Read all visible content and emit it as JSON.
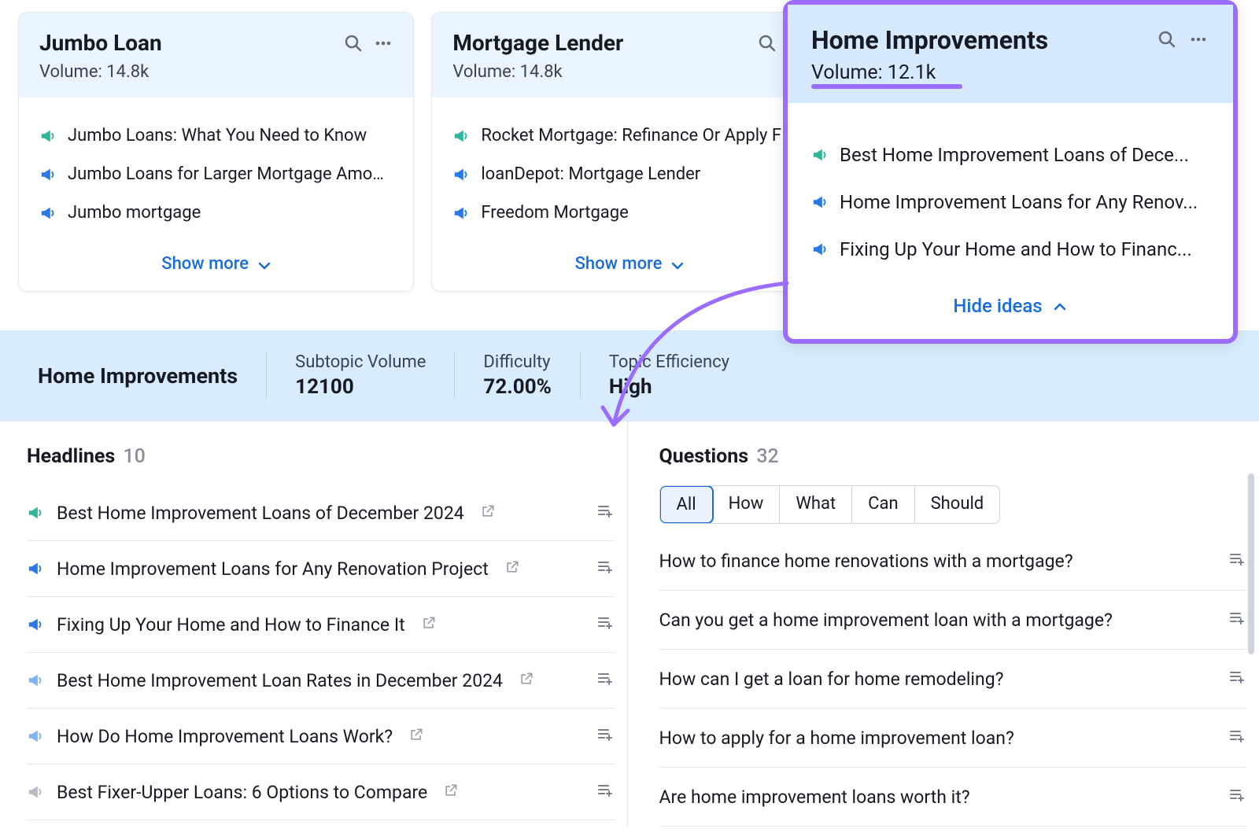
{
  "cards": [
    {
      "title": "Jumbo Loan",
      "volume_label": "Volume: 14.8k",
      "ideas": [
        {
          "text": "Jumbo Loans: What You Need to Know",
          "color": "teal"
        },
        {
          "text": "Jumbo Loans for Larger Mortgage Amou...",
          "color": "blue"
        },
        {
          "text": "Jumbo mortgage",
          "color": "blue"
        }
      ],
      "show_more": "Show more"
    },
    {
      "title": "Mortgage Lender",
      "volume_label": "Volume: 14.8k",
      "ideas": [
        {
          "text": "Rocket Mortgage: Refinance Or Apply F",
          "color": "teal"
        },
        {
          "text": "loanDepot: Mortgage Lender",
          "color": "blue"
        },
        {
          "text": "Freedom Mortgage",
          "color": "blue"
        }
      ],
      "show_more": "Show more"
    }
  ],
  "highlighted": {
    "title": "Home Improvements",
    "volume_label": "Volume: 12.1k",
    "ideas": [
      {
        "text": "Best Home Improvement Loans of Dece...",
        "color": "teal"
      },
      {
        "text": "Home Improvement Loans for Any Renov...",
        "color": "blue"
      },
      {
        "text": "Fixing Up Your Home and How to Financ...",
        "color": "blue"
      }
    ],
    "hide_ideas": "Hide ideas"
  },
  "details": {
    "title": "Home Improvements",
    "metrics": [
      {
        "label": "Subtopic Volume",
        "value": "12100"
      },
      {
        "label": "Difficulty",
        "value": "72.00%"
      },
      {
        "label": "Topic Efficiency",
        "value": "High"
      }
    ]
  },
  "headlines": {
    "title": "Headlines",
    "count": "10",
    "items": [
      {
        "text": "Best Home Improvement Loans of December 2024",
        "color": "teal"
      },
      {
        "text": "Home Improvement Loans for Any Renovation Project",
        "color": "blue"
      },
      {
        "text": "Fixing Up Your Home and How to Finance It",
        "color": "blue"
      },
      {
        "text": "Best Home Improvement Loan Rates in December 2024",
        "color": "bluefade"
      },
      {
        "text": "How Do Home Improvement Loans Work?",
        "color": "bluefade"
      },
      {
        "text": "Best Fixer-Upper Loans: 6 Options to Compare",
        "color": "gray"
      }
    ]
  },
  "questions": {
    "title": "Questions",
    "count": "32",
    "filters": [
      "All",
      "How",
      "What",
      "Can",
      "Should"
    ],
    "active_filter": "All",
    "items": [
      "How to finance home renovations with a mortgage?",
      "Can you get a home improvement loan with a mortgage?",
      "How can I get a loan for home remodeling?",
      "How to apply for a home improvement loan?",
      "Are home improvement loans worth it?"
    ]
  },
  "icons": {
    "teal": "#30b49a",
    "blue": "#2a78e4",
    "bluefade": "#7db3f0",
    "gray": "#b5bac3"
  }
}
